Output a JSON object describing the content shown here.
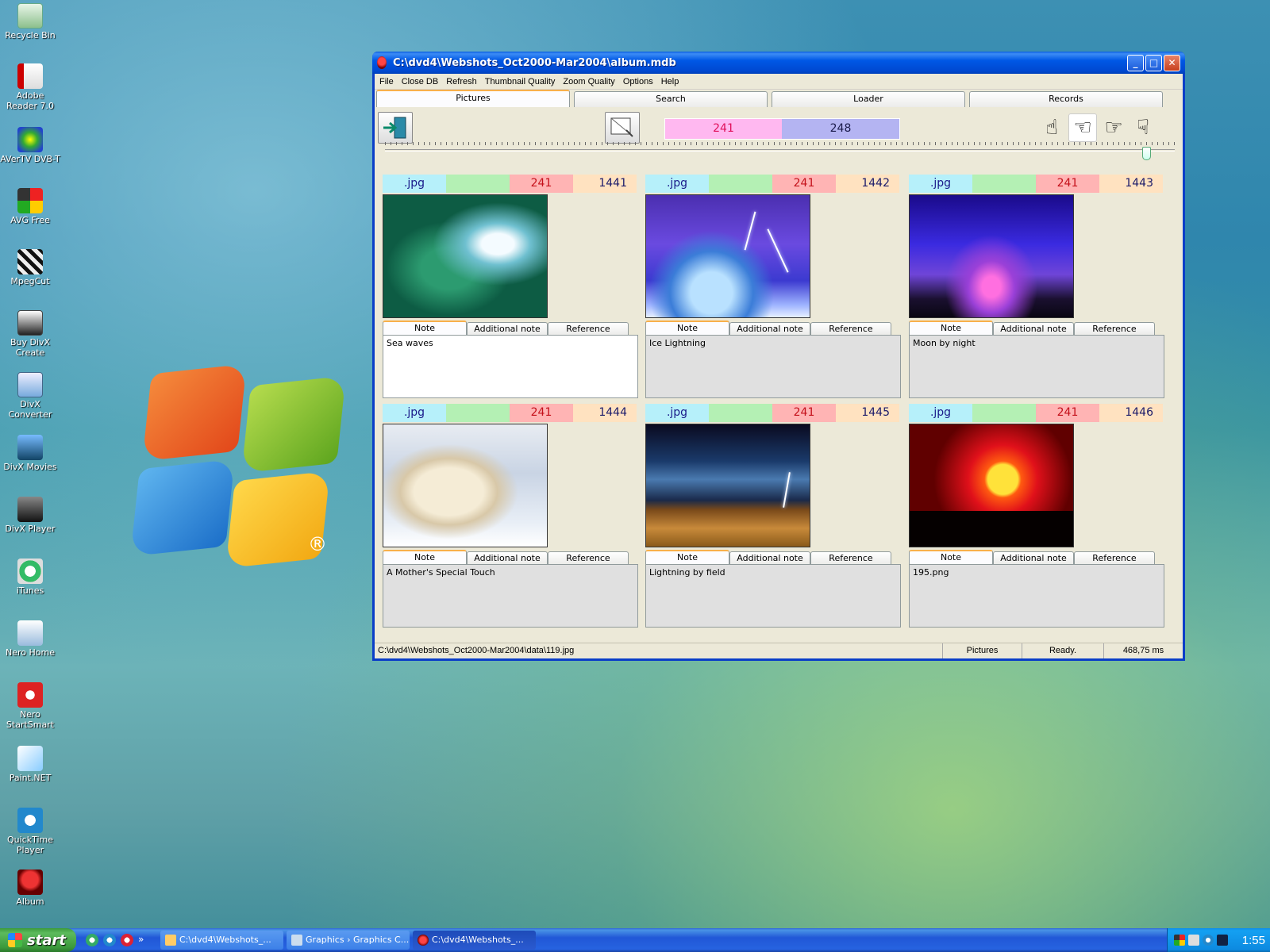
{
  "desktop": {
    "icons": [
      {
        "label": "Recycle Bin",
        "icon": "recycle-bin-icon"
      },
      {
        "label": "Adobe Reader 7.0",
        "icon": "adobe-reader-icon"
      },
      {
        "label": "AVerTV DVB-T",
        "icon": "avertv-icon"
      },
      {
        "label": "AVG Free",
        "icon": "avg-icon"
      },
      {
        "label": "MpegCut",
        "icon": "clapperboard-icon"
      },
      {
        "label": "Buy DivX Create",
        "icon": "divx-icon"
      },
      {
        "label": "DivX Converter",
        "icon": "divx-converter-icon"
      },
      {
        "label": "DivX Movies",
        "icon": "divx-movies-icon"
      },
      {
        "label": "DivX Player",
        "icon": "divx-player-icon"
      },
      {
        "label": "iTunes",
        "icon": "itunes-icon"
      },
      {
        "label": "Nero Home",
        "icon": "nero-home-icon"
      },
      {
        "label": "Nero StartSmart",
        "icon": "nero-startsmart-icon"
      },
      {
        "label": "Paint.NET",
        "icon": "paintnet-icon"
      },
      {
        "label": "QuickTime Player",
        "icon": "quicktime-icon"
      },
      {
        "label": "Album",
        "icon": "album-icon"
      }
    ],
    "logo_mark": "®"
  },
  "window": {
    "title": "C:\\dvd4\\Webshots_Oct2000-Mar2004\\album.mdb",
    "controls": {
      "minimize": "_",
      "maximize": "□",
      "close": "✕"
    },
    "menu": [
      "File",
      "Close DB",
      "Refresh",
      "Thumbnail Quality",
      "Zoom Quality",
      "Options",
      "Help"
    ],
    "tabs": [
      "Pictures",
      "Search",
      "Loader",
      "Records"
    ],
    "active_tab": "Pictures",
    "toolbar": {
      "counter_current": "241",
      "counter_total": "248",
      "hands": [
        "☝",
        "☜",
        "☞",
        "☟"
      ]
    },
    "slider": {
      "value_fraction": 0.97
    },
    "pictures": [
      {
        "ext": ".jpg",
        "group": "241",
        "id": "1441",
        "note": "Sea waves",
        "thumb": "waves"
      },
      {
        "ext": ".jpg",
        "group": "241",
        "id": "1442",
        "note": "Ice Lightning",
        "thumb": "ice"
      },
      {
        "ext": ".jpg",
        "group": "241",
        "id": "1443",
        "note": "Moon by night",
        "thumb": "moon"
      },
      {
        "ext": ".jpg",
        "group": "241",
        "id": "1444",
        "note": "A Mother's Special Touch",
        "thumb": "bears"
      },
      {
        "ext": ".jpg",
        "group": "241",
        "id": "1445",
        "note": "Lightning by field",
        "thumb": "storm"
      },
      {
        "ext": ".jpg",
        "group": "241",
        "id": "1446",
        "note": "195.png",
        "thumb": "sunset"
      }
    ],
    "note_tabs": [
      "Note",
      "Additional note",
      "Reference"
    ],
    "status": {
      "path": "C:\\dvd4\\Webshots_Oct2000-Mar2004\\data\\119.jpg",
      "section": "Pictures",
      "state": "Ready.",
      "timing": "468,75 ms"
    }
  },
  "taskbar": {
    "start_label": "start",
    "more": "»",
    "tasks": [
      {
        "label": "C:\\dvd4\\Webshots_...",
        "active": false
      },
      {
        "label": "Graphics › Graphics C...",
        "active": false
      },
      {
        "label": "C:\\dvd4\\Webshots_...",
        "active": true
      }
    ],
    "clock": "1:55"
  }
}
